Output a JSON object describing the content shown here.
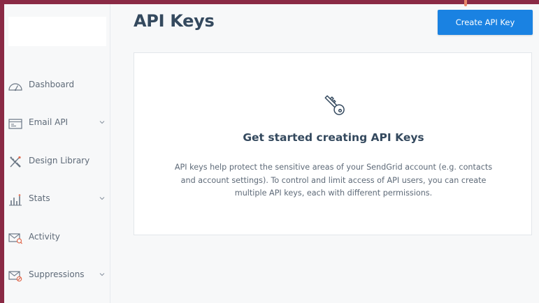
{
  "sidebar": {
    "items": [
      {
        "label": "Dashboard",
        "icon": "gauge-icon",
        "has_chevron": false
      },
      {
        "label": "Email API",
        "icon": "terminal-window-icon",
        "has_chevron": true
      },
      {
        "label": "Design Library",
        "icon": "pencil-ruler-icon",
        "has_chevron": false
      },
      {
        "label": "Stats",
        "icon": "bar-chart-icon",
        "has_chevron": true
      },
      {
        "label": "Activity",
        "icon": "envelope-search-icon",
        "has_chevron": false
      },
      {
        "label": "Suppressions",
        "icon": "envelope-block-icon",
        "has_chevron": true
      }
    ]
  },
  "header": {
    "title": "API Keys",
    "create_button_label": "Create API Key"
  },
  "empty_state": {
    "icon": "key-icon",
    "heading": "Get started creating API Keys",
    "description": "API keys help protect the sensitive areas of your SendGrid account (e.g. contacts and account settings). To control and limit access of API users, you can create multiple API keys, each with different permissions."
  },
  "colors": {
    "frame_background": "#8a2a45",
    "primary_button": "#1a82e2",
    "title_text": "#34495e",
    "muted_text": "#5e6a78",
    "annotation_arrow": "#e8876a"
  }
}
